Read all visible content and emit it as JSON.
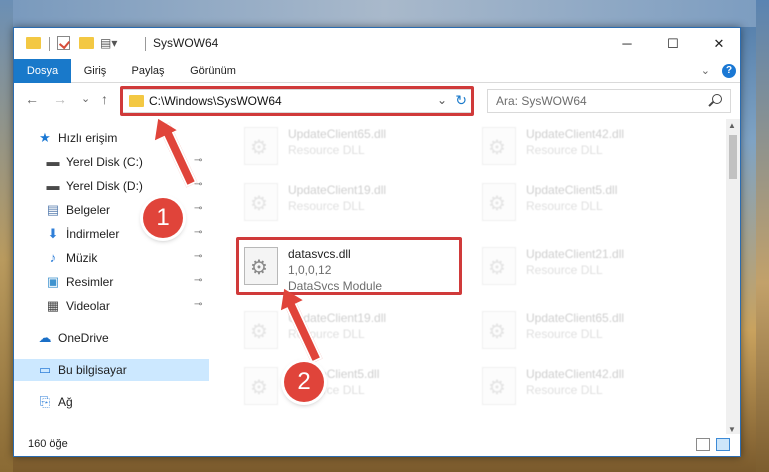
{
  "window": {
    "title": "SysWOW64",
    "minimize": "─",
    "maximize": "☐",
    "close": "✕"
  },
  "ribbon": {
    "tabs": [
      {
        "label": "Dosya",
        "active": true
      },
      {
        "label": "Giriş",
        "active": false
      },
      {
        "label": "Paylaş",
        "active": false
      },
      {
        "label": "Görünüm",
        "active": false
      }
    ],
    "expand": "⌄",
    "help": "?"
  },
  "nav": {
    "back": "←",
    "forward": "→",
    "recent": "⌄",
    "up": "↑",
    "address": "C:\\Windows\\SysWOW64",
    "dropdown": "⌄",
    "refresh": "↻",
    "search_placeholder": "Ara: SysWOW64"
  },
  "sidebar": {
    "items": [
      {
        "label": "Hızlı erişim",
        "icon": "star-icon",
        "glyph": "★",
        "color": "#1a78d4",
        "pinned": false
      },
      {
        "label": "Yerel Disk (C:)",
        "icon": "drive-icon",
        "glyph": "▬",
        "color": "#4a4a4a",
        "pinned": true
      },
      {
        "label": "Yerel Disk (D:)",
        "icon": "drive-icon",
        "glyph": "▬",
        "color": "#4a4a4a",
        "pinned": true
      },
      {
        "label": "Belgeler",
        "icon": "documents-icon",
        "glyph": "▤",
        "color": "#5a7fb0",
        "pinned": true
      },
      {
        "label": "İndirmeler",
        "icon": "download-icon",
        "glyph": "⬇",
        "color": "#2f7fd8",
        "pinned": true
      },
      {
        "label": "Müzik",
        "icon": "music-icon",
        "glyph": "♪",
        "color": "#2f7fd8",
        "pinned": true
      },
      {
        "label": "Resimler",
        "icon": "pictures-icon",
        "glyph": "▣",
        "color": "#3f93cf",
        "pinned": true
      },
      {
        "label": "Videolar",
        "icon": "videos-icon",
        "glyph": "▦",
        "color": "#444",
        "pinned": true
      },
      {
        "label": "OneDrive",
        "icon": "cloud-icon",
        "glyph": "☁",
        "color": "#1a6fc7",
        "pinned": false
      },
      {
        "label": "Bu bilgisayar",
        "icon": "computer-icon",
        "glyph": "▭",
        "color": "#2f7fd8",
        "pinned": false
      },
      {
        "label": "Ağ",
        "icon": "network-icon",
        "glyph": "⎘",
        "color": "#2f7fd8",
        "pinned": false
      }
    ],
    "pin_glyph": "📌"
  },
  "files": [
    {
      "name": "UpdateClient65.dll",
      "meta1": "Resource DLL",
      "meta2": ""
    },
    {
      "name": "UpdateClient42.dll",
      "meta1": "Resource DLL",
      "meta2": ""
    },
    {
      "name": "UpdateClient19.dll",
      "meta1": "Resource DLL",
      "meta2": ""
    },
    {
      "name": "UpdateClient5.dll",
      "meta1": "Resource DLL",
      "meta2": ""
    },
    {
      "name": "datasvcs.dll",
      "meta1": "1,0,0,12",
      "meta2": "DataSvcs Module"
    },
    {
      "name": "UpdateClient21.dll",
      "meta1": "Resource DLL",
      "meta2": ""
    },
    {
      "name": "UpdateClient19.dll",
      "meta1": "Resource DLL",
      "meta2": ""
    },
    {
      "name": "UpdateClient65.dll",
      "meta1": "Resource DLL",
      "meta2": ""
    },
    {
      "name": "UpdateClient5.dll",
      "meta1": "Resource DLL",
      "meta2": ""
    },
    {
      "name": "UpdateClient42.dll",
      "meta1": "Resource DLL",
      "meta2": ""
    }
  ],
  "status": {
    "count": "160 öğe"
  },
  "annotations": {
    "step1": "1",
    "step2": "2",
    "color": "#e0443a"
  }
}
